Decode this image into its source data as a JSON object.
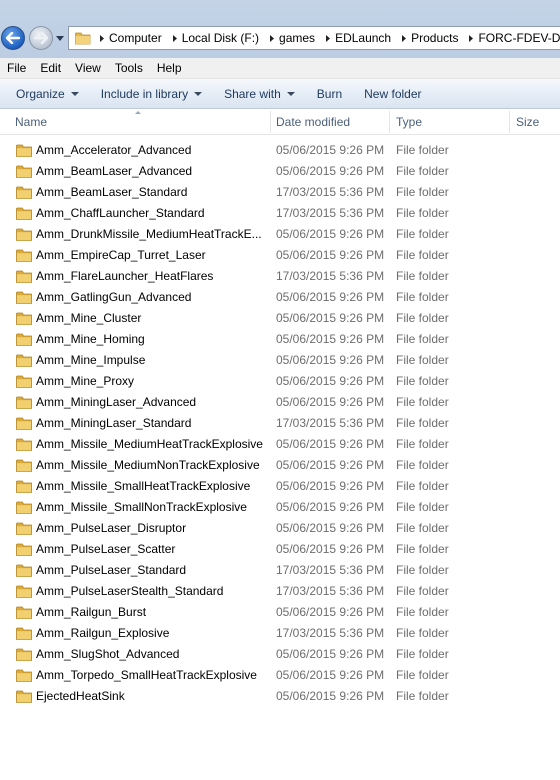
{
  "address_bar": {
    "crumbs": [
      "Computer",
      "Local Disk (F:)",
      "games",
      "EDLaunch",
      "Products",
      "FORC-FDEV-D"
    ]
  },
  "menu": [
    "File",
    "Edit",
    "View",
    "Tools",
    "Help"
  ],
  "commands": {
    "organize": "Organize",
    "include_in_library": "Include in library",
    "share_with": "Share with",
    "burn": "Burn",
    "new_folder": "New folder"
  },
  "columns": {
    "name": "Name",
    "date_modified": "Date modified",
    "type": "Type",
    "size": "Size"
  },
  "files": [
    {
      "name": "Amm_Accelerator_Advanced",
      "date": "05/06/2015 9:26 PM",
      "type": "File folder"
    },
    {
      "name": "Amm_BeamLaser_Advanced",
      "date": "05/06/2015 9:26 PM",
      "type": "File folder"
    },
    {
      "name": "Amm_BeamLaser_Standard",
      "date": "17/03/2015 5:36 PM",
      "type": "File folder"
    },
    {
      "name": "Amm_ChaffLauncher_Standard",
      "date": "17/03/2015 5:36 PM",
      "type": "File folder"
    },
    {
      "name": "Amm_DrunkMissile_MediumHeatTrackE...",
      "date": "05/06/2015 9:26 PM",
      "type": "File folder"
    },
    {
      "name": "Amm_EmpireCap_Turret_Laser",
      "date": "05/06/2015 9:26 PM",
      "type": "File folder"
    },
    {
      "name": "Amm_FlareLauncher_HeatFlares",
      "date": "17/03/2015 5:36 PM",
      "type": "File folder"
    },
    {
      "name": "Amm_GatlingGun_Advanced",
      "date": "05/06/2015 9:26 PM",
      "type": "File folder"
    },
    {
      "name": "Amm_Mine_Cluster",
      "date": "05/06/2015 9:26 PM",
      "type": "File folder"
    },
    {
      "name": "Amm_Mine_Homing",
      "date": "05/06/2015 9:26 PM",
      "type": "File folder"
    },
    {
      "name": "Amm_Mine_Impulse",
      "date": "05/06/2015 9:26 PM",
      "type": "File folder"
    },
    {
      "name": "Amm_Mine_Proxy",
      "date": "05/06/2015 9:26 PM",
      "type": "File folder"
    },
    {
      "name": "Amm_MiningLaser_Advanced",
      "date": "05/06/2015 9:26 PM",
      "type": "File folder"
    },
    {
      "name": "Amm_MiningLaser_Standard",
      "date": "17/03/2015 5:36 PM",
      "type": "File folder"
    },
    {
      "name": "Amm_Missile_MediumHeatTrackExplosive",
      "date": "05/06/2015 9:26 PM",
      "type": "File folder"
    },
    {
      "name": "Amm_Missile_MediumNonTrackExplosive",
      "date": "05/06/2015 9:26 PM",
      "type": "File folder"
    },
    {
      "name": "Amm_Missile_SmallHeatTrackExplosive",
      "date": "05/06/2015 9:26 PM",
      "type": "File folder"
    },
    {
      "name": "Amm_Missile_SmallNonTrackExplosive",
      "date": "05/06/2015 9:26 PM",
      "type": "File folder"
    },
    {
      "name": "Amm_PulseLaser_Disruptor",
      "date": "05/06/2015 9:26 PM",
      "type": "File folder"
    },
    {
      "name": "Amm_PulseLaser_Scatter",
      "date": "05/06/2015 9:26 PM",
      "type": "File folder"
    },
    {
      "name": "Amm_PulseLaser_Standard",
      "date": "17/03/2015 5:36 PM",
      "type": "File folder"
    },
    {
      "name": "Amm_PulseLaserStealth_Standard",
      "date": "17/03/2015 5:36 PM",
      "type": "File folder"
    },
    {
      "name": "Amm_Railgun_Burst",
      "date": "05/06/2015 9:26 PM",
      "type": "File folder"
    },
    {
      "name": "Amm_Railgun_Explosive",
      "date": "17/03/2015 5:36 PM",
      "type": "File folder"
    },
    {
      "name": "Amm_SlugShot_Advanced",
      "date": "05/06/2015 9:26 PM",
      "type": "File folder"
    },
    {
      "name": "Amm_Torpedo_SmallHeatTrackExplosive",
      "date": "05/06/2015 9:26 PM",
      "type": "File folder"
    },
    {
      "name": "EjectedHeatSink",
      "date": "05/06/2015 9:26 PM",
      "type": "File folder"
    }
  ],
  "colors": {
    "folder": "#e8c15a",
    "command_text": "#1e395b",
    "header_text": "#4c607a",
    "meta_text": "#6d6d6d"
  }
}
